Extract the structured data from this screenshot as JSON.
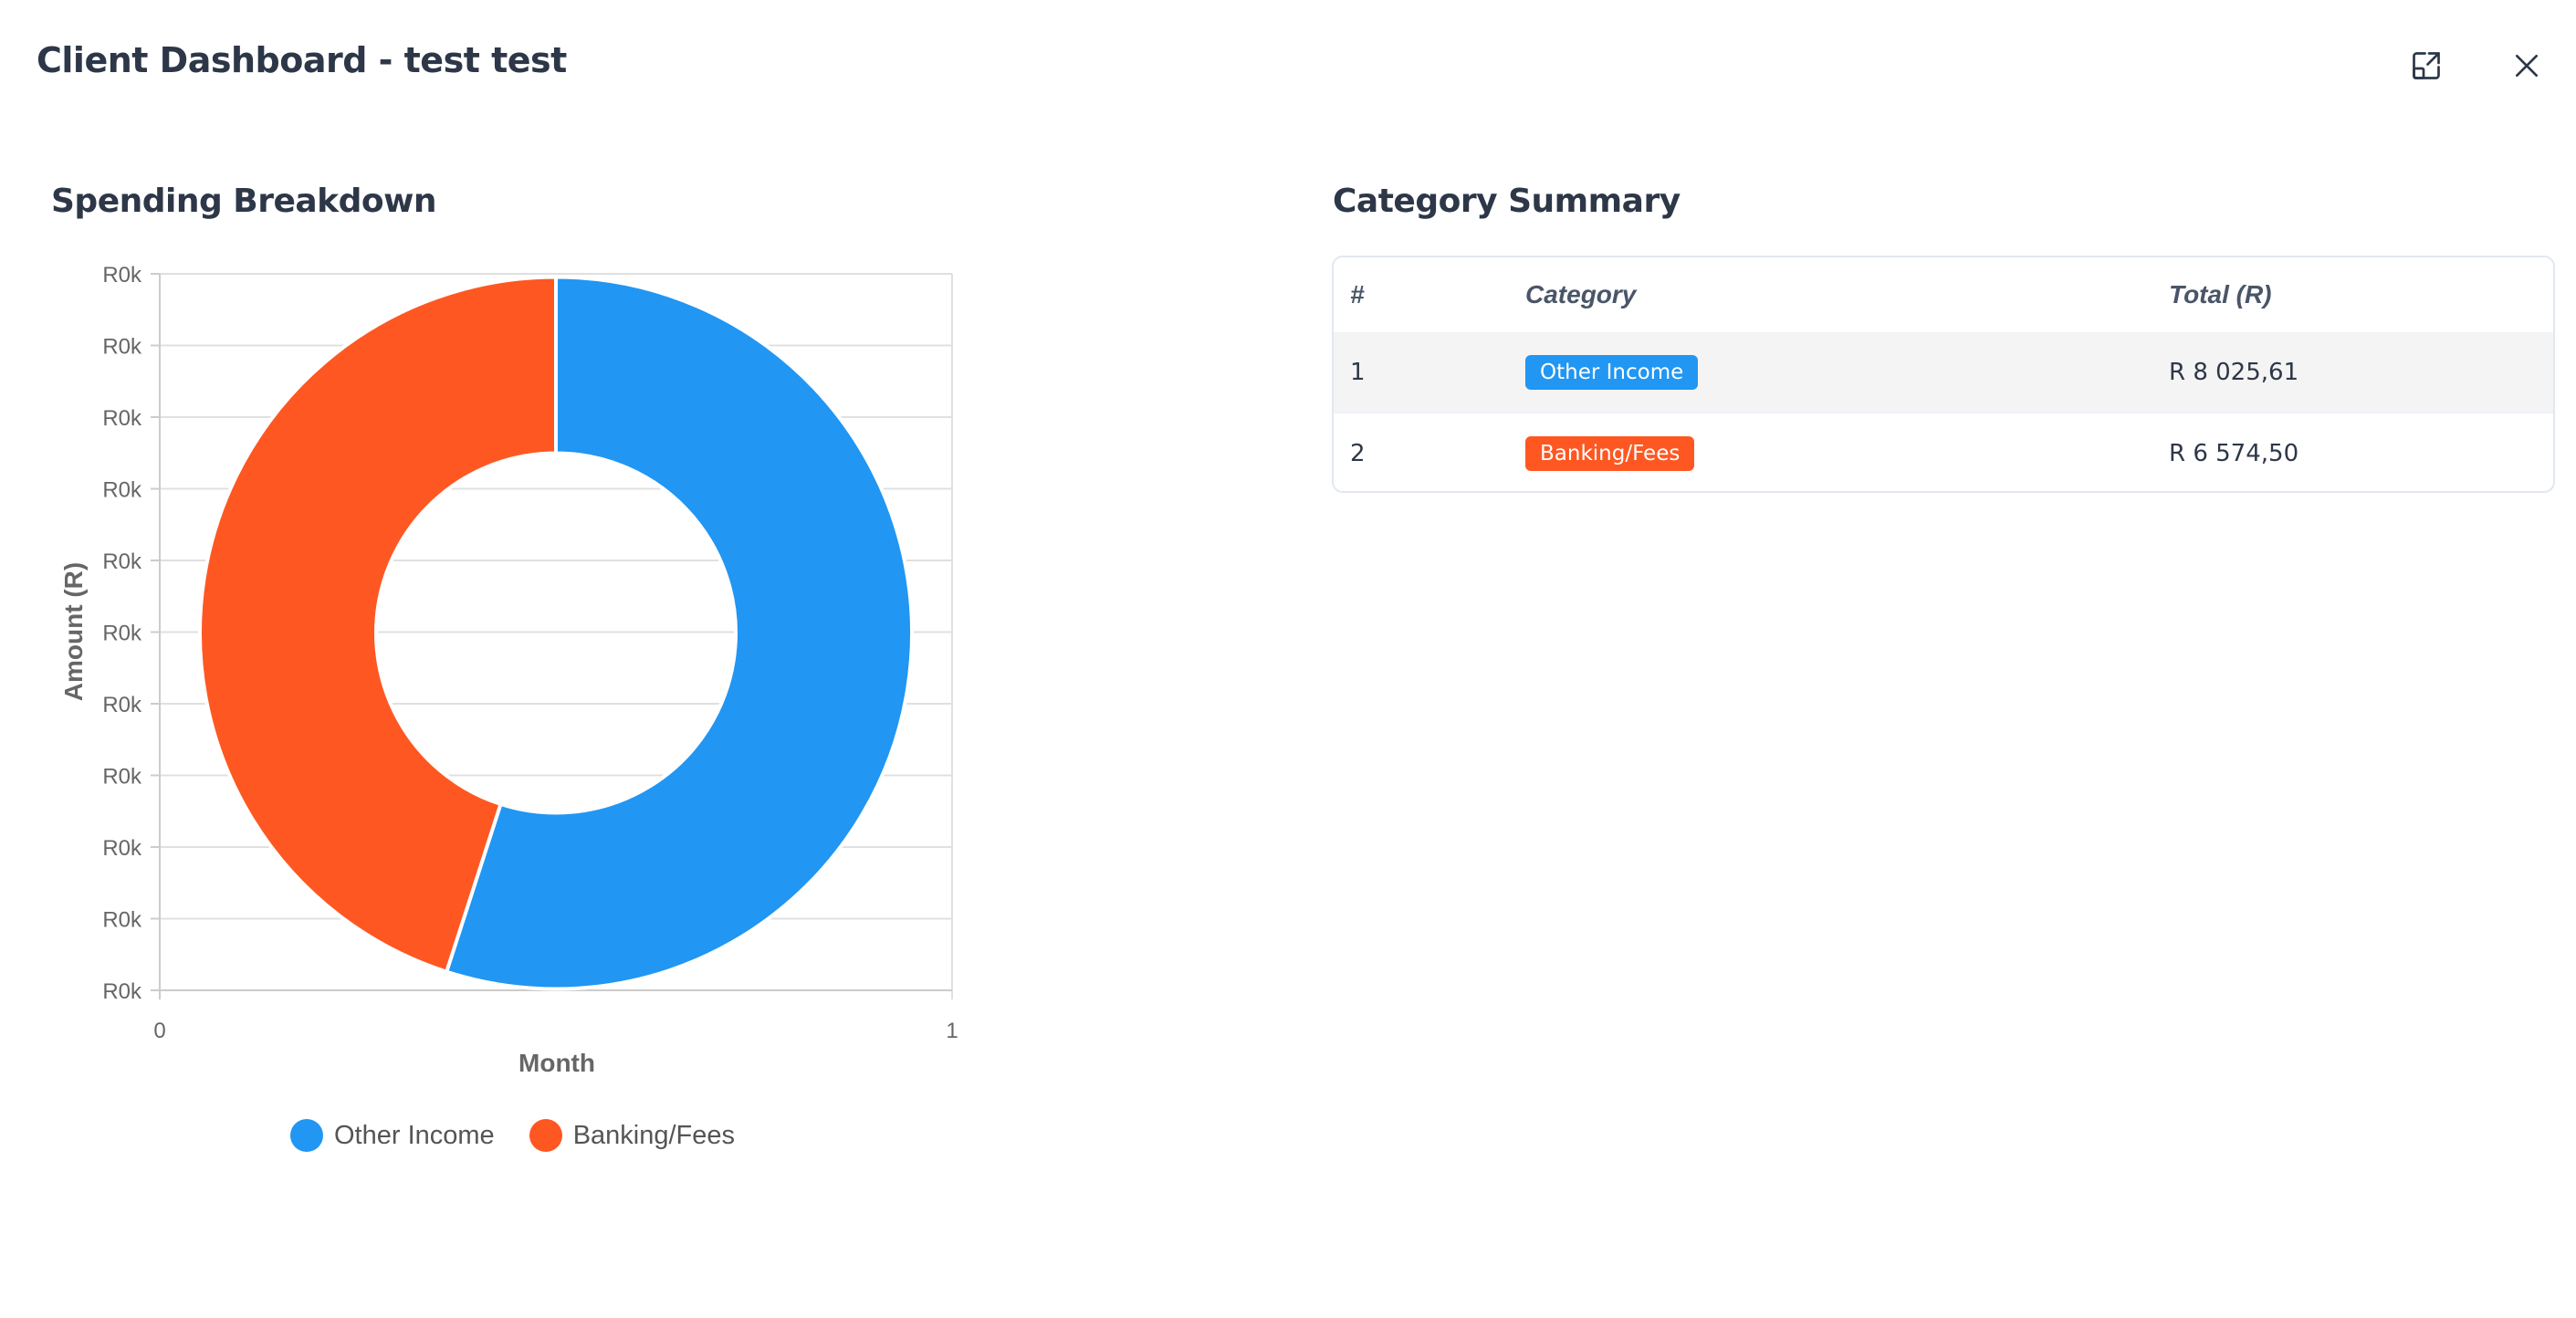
{
  "modal": {
    "title": "Client Dashboard - test test",
    "expand_icon": "expand-icon",
    "close_icon": "close-icon"
  },
  "chart_section": {
    "title": "Spending Breakdown"
  },
  "summary_section": {
    "title": "Category Summary",
    "columns": [
      "#",
      "Category",
      "Total (R)"
    ],
    "rows": [
      {
        "num": "1",
        "category": "Other Income",
        "total": "R 8 025,61",
        "color": "#2196f3"
      },
      {
        "num": "2",
        "category": "Banking/Fees",
        "total": "R 6 574,50",
        "color": "#ff5722"
      }
    ]
  },
  "chart_data": {
    "type": "pie",
    "donut": true,
    "title": "",
    "xlabel": "Month",
    "ylabel": "Amount (R)",
    "y_tick_labels": [
      "R0k",
      "R0k",
      "R0k",
      "R0k",
      "R0k",
      "R0k",
      "R0k",
      "R0k",
      "R0k",
      "R0k",
      "R0k"
    ],
    "x_tick_labels": [
      "0",
      "1"
    ],
    "grid": true,
    "legend_position": "bottom",
    "series": [
      {
        "name": "Other Income",
        "value": 8025.61,
        "color": "#2196f3"
      },
      {
        "name": "Banking/Fees",
        "value": 6574.5,
        "color": "#ff5722"
      }
    ]
  }
}
